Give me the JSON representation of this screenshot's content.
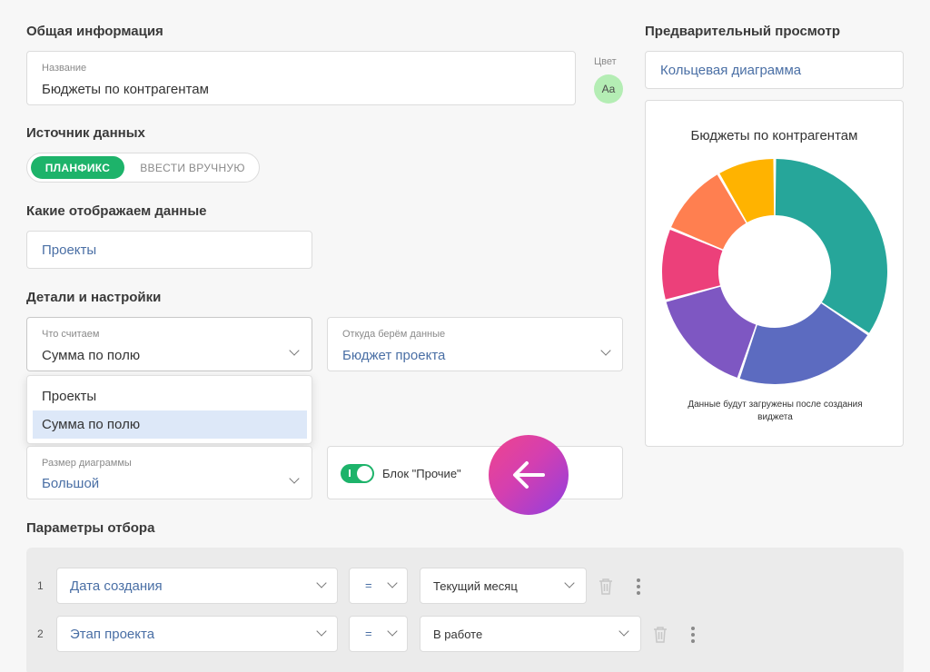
{
  "general": {
    "section_title": "Общая информация",
    "name_label": "Название",
    "name_value": "Бюджеты по контрагентам",
    "color_label": "Цвет",
    "color_chip_text": "Aa",
    "color_chip_color": "#b4edb4"
  },
  "source": {
    "section_title": "Источник данных",
    "options": [
      "ПЛАНФИКС",
      "ВВЕСТИ ВРУЧНУЮ"
    ],
    "active_color": "#1db36a"
  },
  "data_shown": {
    "section_title": "Какие отображаем данные",
    "value": "Проекты"
  },
  "details": {
    "section_title": "Детали и настройки",
    "what_count_label": "Что считаем",
    "what_count_value": "Сумма по полю",
    "from_label": "Откуда берём данные",
    "from_value": "Бюджет проекта",
    "dropdown_options": [
      "Проекты",
      "Сумма по полю"
    ],
    "dropdown_selected": "Сумма по полю",
    "size_label": "Размер диаграммы",
    "size_value": "Большой",
    "other_block_label": "Блок \"Прочие\"",
    "other_block_enabled": true
  },
  "preview": {
    "section_title": "Предварительный просмотр",
    "chart_type_value": "Кольцевая диаграмма",
    "chart_title": "Бюджеты по контрагентам",
    "note": "Данные будут загружены после создания виджета"
  },
  "filters": {
    "section_title": "Параметры отбора",
    "rows": [
      {
        "num": "1",
        "field": "Дата создания",
        "op": "=",
        "value": "Текущий месяц"
      },
      {
        "num": "2",
        "field": "Этап проекта",
        "op": "=",
        "value": "В работе"
      }
    ]
  },
  "chart_data": {
    "type": "pie",
    "title": "Бюджеты по контрагентам",
    "variant": "donut",
    "values": [
      33,
      20,
      15,
      10,
      10,
      8
    ],
    "colors": [
      "#26a69a",
      "#5c6bc0",
      "#7e57c2",
      "#ec407a",
      "#ff7f50",
      "#ffb300"
    ]
  },
  "fab": {
    "icon": "arrow-left-icon"
  }
}
